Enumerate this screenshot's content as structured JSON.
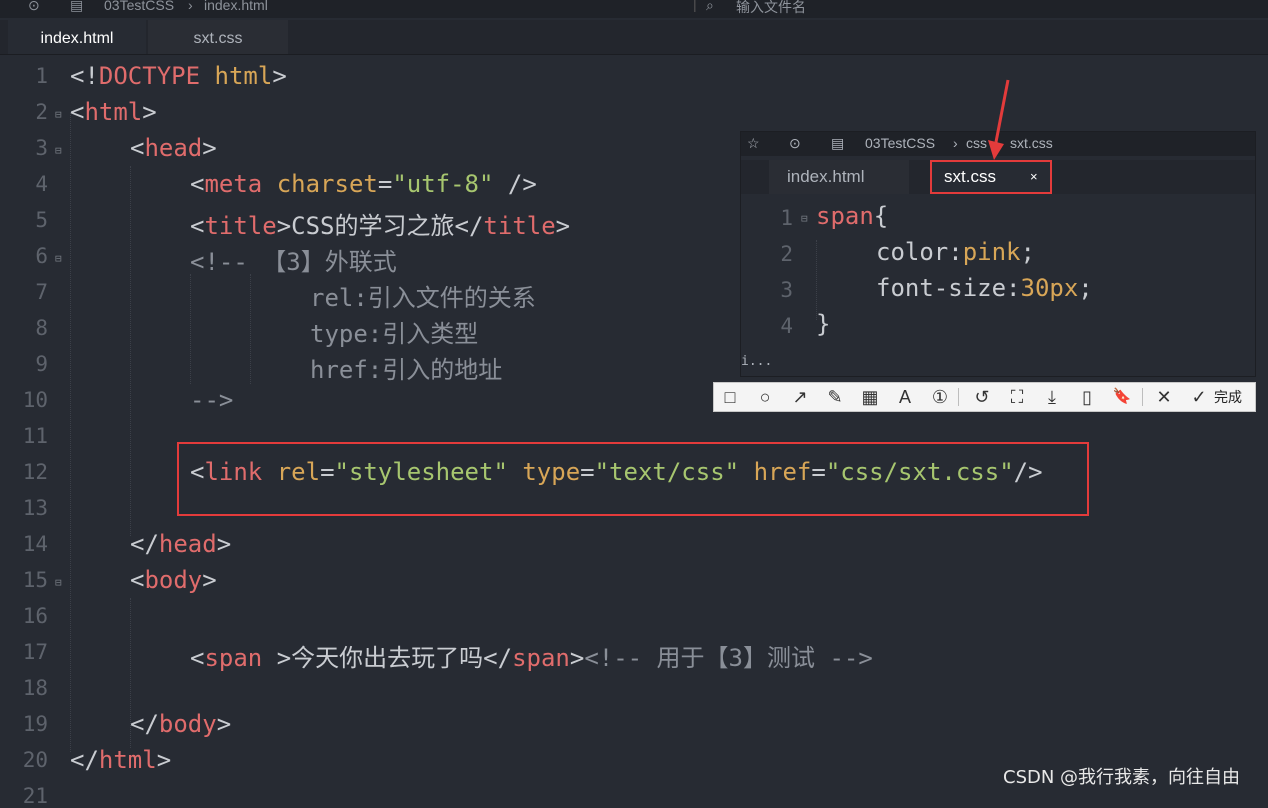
{
  "topbar": {
    "project": "03TestCSS",
    "file": "index.html",
    "search_placeholder": "输入文件名"
  },
  "tabs": [
    {
      "label": "index.html",
      "active": true
    },
    {
      "label": "sxt.css",
      "active": false
    }
  ],
  "editor": {
    "line_numbers": [
      "1",
      "2",
      "3",
      "4",
      "5",
      "6",
      "7",
      "8",
      "9",
      "10",
      "11",
      "12",
      "13",
      "14",
      "15",
      "16",
      "17",
      "18",
      "19",
      "20",
      "21"
    ],
    "lines": {
      "l1": {
        "p1": "<!",
        "t": "DOCTYPE",
        "sp": " ",
        "a": "html",
        "p2": ">"
      },
      "l2": {
        "p1": "<",
        "t": "html",
        "p2": ">"
      },
      "l3": {
        "p1": "<",
        "t": "head",
        "p2": ">"
      },
      "l4": {
        "p1": "<",
        "t": "meta",
        "a1": "charset",
        "eq": "=",
        "s1": "\"utf-8\"",
        "p2": " />"
      },
      "l5": {
        "p1": "<",
        "t1": "title",
        "p2": ">",
        "text": "CSS的学习之旅",
        "p3": "</",
        "t2": "title",
        "p4": ">"
      },
      "l6": "<!-- 【3】外联式",
      "l7": "rel:引入文件的关系",
      "l8": "type:引入类型",
      "l9": "href:引入的地址",
      "l10": "-->",
      "l12": {
        "p1": "<",
        "t": "link",
        "a1": "rel",
        "s1": "\"stylesheet\"",
        "a2": "type",
        "s2": "\"text/css\"",
        "a3": "href",
        "s3": "\"css/sxt.css\"",
        "p2": "/>",
        "eq": "="
      },
      "l14": {
        "p1": "</",
        "t": "head",
        "p2": ">"
      },
      "l15": {
        "p1": "<",
        "t": "body",
        "p2": ">"
      },
      "l17": {
        "p1": "<",
        "t1": "span",
        "p2": " >",
        "text": "今天你出去玩了吗",
        "p3": "</",
        "t2": "span",
        "p4": ">",
        "c": "<!-- 用于【3】测试 -->"
      },
      "l19": {
        "p1": "</",
        "t": "body",
        "p2": ">"
      },
      "l20": {
        "p1": "</",
        "t": "html",
        "p2": ">"
      }
    }
  },
  "popup": {
    "breadcrumb": {
      "project": "03TestCSS",
      "folder": "css",
      "file": "sxt.css"
    },
    "tabs": [
      {
        "label": "index.html",
        "active": false
      },
      {
        "label": "sxt.css",
        "active": true,
        "close": "×"
      }
    ],
    "line_numbers": [
      "1",
      "2",
      "3",
      "4"
    ],
    "lines": {
      "l1": {
        "sel": "span",
        "brace": "{"
      },
      "l2": {
        "prop": "color",
        "colon": ":",
        "val": "pink",
        "semi": ";"
      },
      "l3": {
        "prop": "font-size",
        "colon": ":",
        "val": "30px",
        "semi": ";"
      },
      "l4": {
        "brace": "}"
      }
    },
    "truncated": "i..."
  },
  "snip_toolbar": {
    "done_label": "完成",
    "icons": [
      "□",
      "○",
      "↗",
      "✎",
      "▦",
      "A",
      "①",
      "↺",
      "⛶",
      "⤓",
      "▯",
      "🔖",
      "✕",
      "✓"
    ]
  },
  "watermark": "CSDN @我行我素，向往自由",
  "colors": {
    "tag": "#e06c6c",
    "attr": "#d8a657",
    "string": "#a7c66f",
    "comment": "#8a8f98",
    "highlight": "#e33b3b"
  }
}
